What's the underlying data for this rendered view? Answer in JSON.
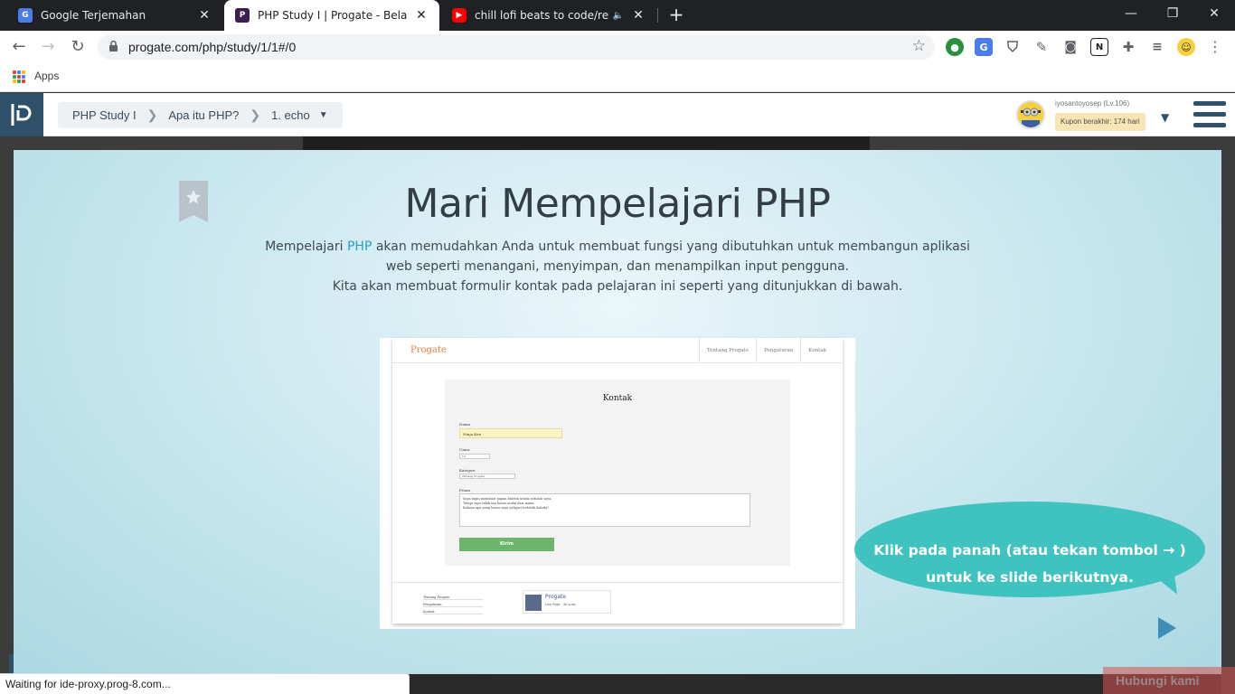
{
  "browser": {
    "tabs": [
      {
        "title": "Google Terjemahan",
        "icon": "google-translate-icon"
      },
      {
        "title": "PHP Study I | Progate - Belajar co",
        "icon": "progate-icon"
      },
      {
        "title": "chill lofi beats to code/relax t",
        "icon": "youtube-icon"
      }
    ],
    "url": "progate.com/php/study/1/1#/0",
    "bookmarks": {
      "apps_label": "Apps"
    },
    "status_text": "Waiting for ide-proxy.prog-8.com..."
  },
  "header": {
    "breadcrumb": [
      "PHP Study I",
      "Apa itu PHP?",
      "1. echo"
    ],
    "user": {
      "name": "iyosantoyosep (Lv.106)",
      "coupon": "Kupon berakhir: 174 hari"
    }
  },
  "slide": {
    "title": "Mari Mempelajari PHP",
    "desc_prefix": "Mempelajari ",
    "desc_highlight": "PHP",
    "desc_rest": " akan memudahkan Anda untuk membuat fungsi yang dibutuhkan untuk membangun aplikasi web seperti menangani, menyimpan, dan menampilkan input pengguna.",
    "desc_line3": "Kita akan membuat formulir kontak pada pelajaran ini seperti yang ditunjukkan di bawah.",
    "example": {
      "logo": "Progate",
      "nav": [
        "Tentang Progate",
        "Pengaturan",
        "Kontak"
      ],
      "form_title": "Kontak",
      "label_name": "Nama",
      "name_value": "Ninja Ken",
      "label_age": "Umur",
      "age_value": "14",
      "label_category": "Kategori",
      "category_value": "Tentang Progate",
      "label_message": "Pesan",
      "message_lines": [
        "Saya ingin membuat papan buletin untuk sekolah saya.",
        "Tetapi saya tidak tau harus mulai dari mana.",
        "Bahasa apa yang harus saya pelajari terlebih dahulu?"
      ],
      "submit": "Kirim",
      "footer_links": [
        "Tentang Progate",
        "Pengaturan",
        "Kontak"
      ],
      "fb_name": "Progate",
      "fb_like": "Like Page · 4K suka"
    },
    "bubble_text": "Klik pada panah (atau tekan tombol → ) untuk ke slide berikutnya."
  },
  "contact_button": "Hubungi kami"
}
